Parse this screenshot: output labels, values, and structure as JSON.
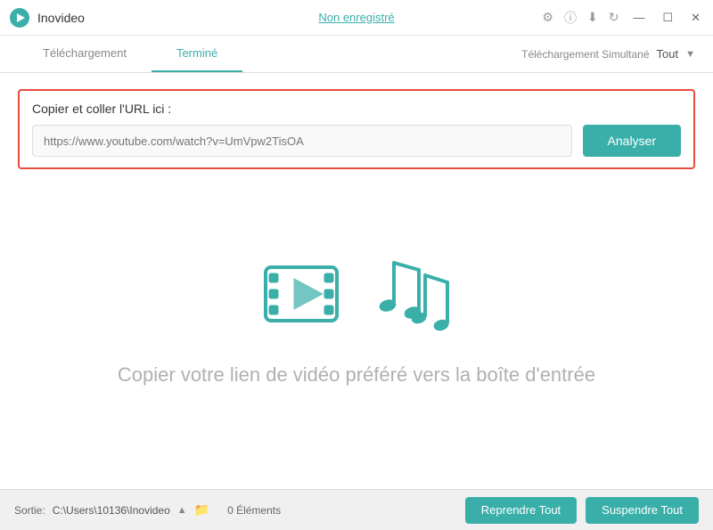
{
  "titlebar": {
    "app_name": "Inovideo",
    "not_registered": "Non enregistré"
  },
  "tabs": {
    "download_label": "Téléchargement",
    "finished_label": "Terminé",
    "simultaneous_label": "Téléchargement Simultané",
    "tout_label": "Tout",
    "active": "finished"
  },
  "url_section": {
    "label": "Copier et coller l'URL ici :",
    "placeholder": "https://www.youtube.com/watch?v=UmVpw2TisOA",
    "analyze_btn": "Analyser"
  },
  "illustration": {
    "text": "Copier votre lien de vidéo préféré vers la boîte d'entrée"
  },
  "footer": {
    "sortie_label": "Sortie:",
    "path": "C:\\Users\\10136\\Inovideo",
    "elements": "0 Éléments",
    "resume_btn": "Reprendre Tout",
    "suspend_btn": "Suspendre Tout"
  },
  "icons": {
    "minimize": "—",
    "maximize": "☐",
    "close": "✕",
    "dropdown": "▼",
    "path_arrow": "▲",
    "settings": "⚙",
    "info": "ⓘ",
    "download2": "⬇",
    "refresh": "↻"
  }
}
